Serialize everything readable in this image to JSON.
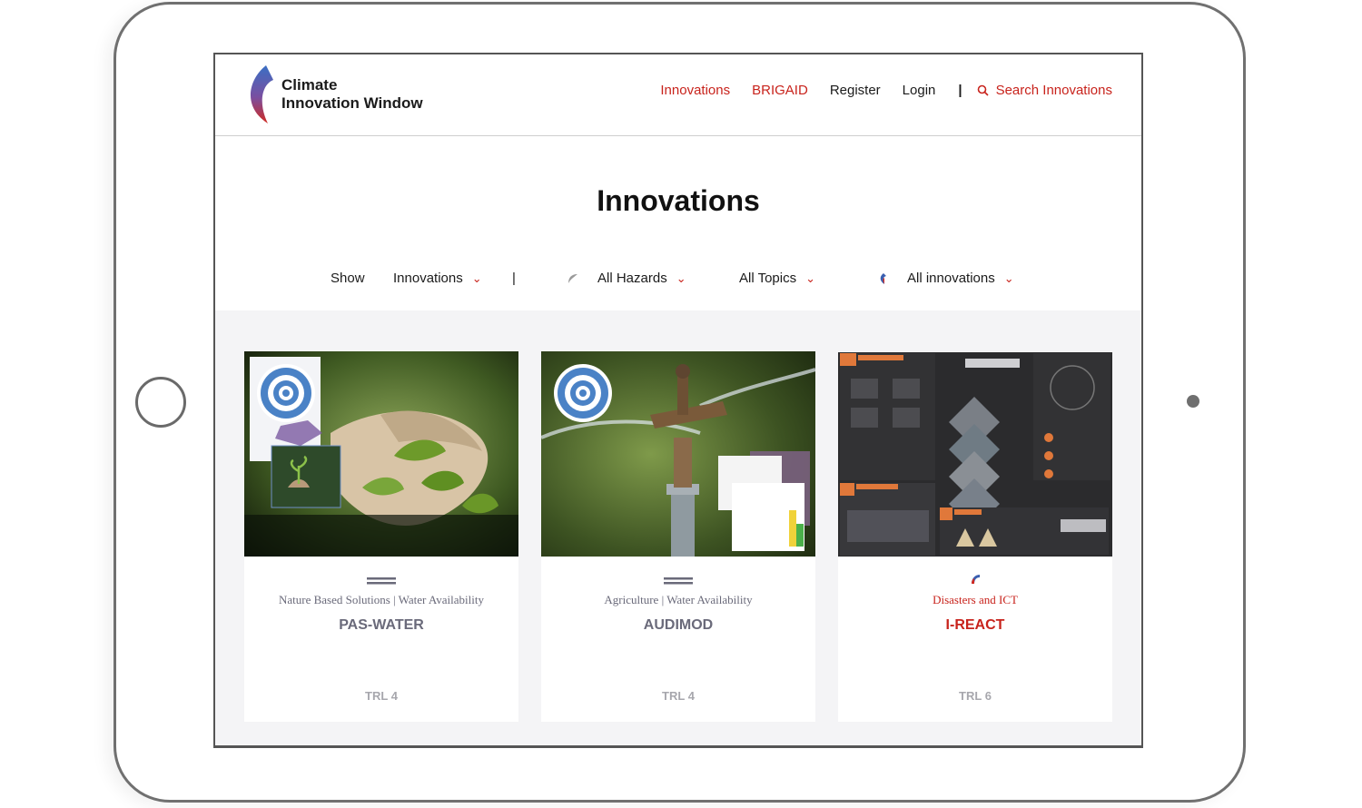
{
  "header": {
    "logo_line1": "Climate",
    "logo_line2": "Innovation Window",
    "nav": {
      "innovations": "Innovations",
      "brigaid": "BRIGAID",
      "register": "Register",
      "login": "Login",
      "separator": "|",
      "search": "Search Innovations"
    }
  },
  "page": {
    "title": "Innovations"
  },
  "filters": {
    "show_label": "Show",
    "type_select": "Innovations",
    "separator": "|",
    "hazards_select": "All Hazards",
    "topics_select": "All Topics",
    "innovations_select": "All innovations"
  },
  "cards": [
    {
      "topics": "Nature Based Solutions | Water Availability",
      "name": "PAS-WATER",
      "trl": "TRL 4"
    },
    {
      "topics": "Agriculture | Water Availability",
      "name": "AUDIMOD",
      "trl": "TRL 4"
    },
    {
      "topics": "Disasters and ICT",
      "name": "I-REACT",
      "trl": "TRL 6"
    }
  ],
  "colors": {
    "accent_red": "#c8231c",
    "card_text": "#6a6a7a",
    "background_gray": "#f4f4f6"
  },
  "icons": [
    "search-icon",
    "chevron-down-icon",
    "hazard-leaf-icon",
    "brand-icon",
    "target-icon"
  ]
}
